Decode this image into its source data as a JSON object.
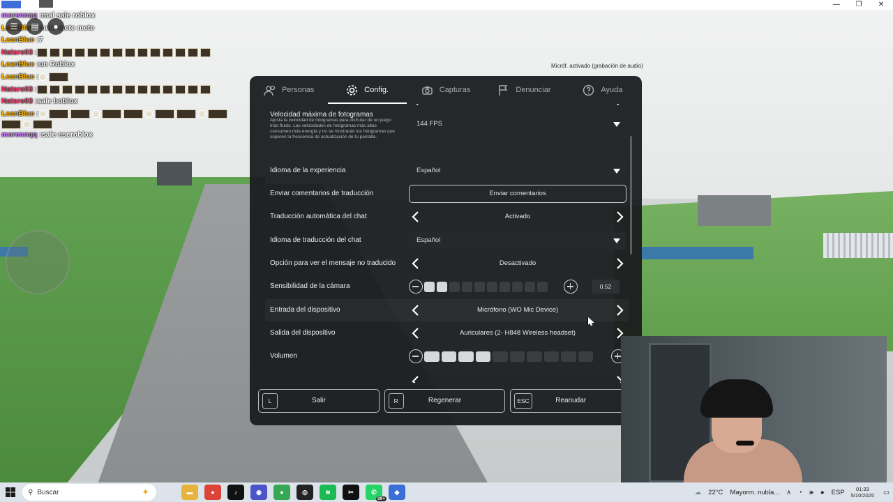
{
  "window": {
    "minimize": "—",
    "restore": "❐",
    "close": "✕"
  },
  "scene": {
    "mic_notice": "Micróf. activado (grabación de audio)"
  },
  "chat": [
    {
      "name": "morennqq",
      "name_color": "#c678f0",
      "sep": " : ",
      "text": "mal sale roblox"
    },
    {
      "name": "LeanBlue",
      "name_color": "#ffb400",
      "sep": " : ",
      "text": "mete mete mete"
    },
    {
      "name": "LeanBlue",
      "name_color": "#ffb400",
      "sep": " : ",
      "text": "7"
    },
    {
      "name": "Natsro03",
      "name_color": "#ff3366",
      "sep": " : ",
      "text": ""
    },
    {
      "name": "LeanBlue",
      "name_color": "#ffb400",
      "sep": " : ",
      "text": "un Roblox"
    },
    {
      "name": "LeanBlue",
      "name_color": "#ffb400",
      "sep": " : ",
      "text": ""
    },
    {
      "name": "Natsro03",
      "name_color": "#ff3366",
      "sep": " : ",
      "text": ""
    },
    {
      "name": "Natsro03",
      "name_color": "#ff3366",
      "sep": " : ",
      "text": "sale boblox"
    },
    {
      "name": "LeanBlue",
      "name_color": "#ffb400",
      "sep": " : ",
      "text": ""
    },
    {
      "name": "morennqq",
      "name_color": "#c678f0",
      "sep": " : ",
      "text": "sale eseroblox"
    }
  ],
  "tabs": [
    {
      "label": "Personas",
      "icon": "people-icon"
    },
    {
      "label": "Config.",
      "icon": "gear-icon",
      "active": true
    },
    {
      "label": "Capturas",
      "icon": "camera-icon"
    },
    {
      "label": "Denunciar",
      "icon": "flag-icon"
    },
    {
      "label": "Ayuda",
      "icon": "help-icon"
    }
  ],
  "settings": {
    "fps": {
      "label": "Velocidad máxima de fotogramas",
      "description": "Ajusta la velocidad de fotogramas para disfrutar de un juego más fluido. Las velocidades de fotogramas más altas consumen más energía y no se mostrarán los fotogramas que superen la frecuencia de actualización de tu pantalla.",
      "value": "144 FPS"
    },
    "experience_language": {
      "label": "Idioma de la experiencia",
      "value": "Español"
    },
    "translation_feedback": {
      "label": "Enviar comentarios de traducción",
      "button": "Enviar comentarios"
    },
    "chat_autotranslate": {
      "label": "Traducción automática del chat",
      "value": "Activado"
    },
    "chat_translation_language": {
      "label": "Idioma de traducción del chat",
      "value": "Español"
    },
    "untranslated_option": {
      "label": "Opción para ver el mensaje no traducido",
      "value": "Desactivado"
    },
    "camera_sensitivity": {
      "label": "Sensibilidad de la cámara",
      "value": "0.52",
      "level": 0.2,
      "segments": 10
    },
    "input_device": {
      "label": "Entrada del dispositivo",
      "value": "Micrófono (WO Mic Device)"
    },
    "output_device": {
      "label": "Salida del dispositivo",
      "value": "Auriculares (2- H848 Wireless headset)"
    },
    "volume": {
      "label": "Volumen",
      "level": 0.4,
      "segments": 10
    }
  },
  "footer": [
    {
      "key": "L",
      "label": "Salir"
    },
    {
      "key": "R",
      "label": "Regenerar"
    },
    {
      "key": "ESC",
      "label": "Reanudar"
    }
  ],
  "taskbar": {
    "search_placeholder": "Buscar",
    "apps": [
      {
        "name": "file-explorer-icon",
        "color": "#e8b33c",
        "glyph": "▬"
      },
      {
        "name": "chrome-icon",
        "color": "#db4437",
        "glyph": "●"
      },
      {
        "name": "tiktok-icon",
        "color": "#111111",
        "glyph": "♪"
      },
      {
        "name": "browser-icon",
        "color": "#4a56c8",
        "glyph": "◉"
      },
      {
        "name": "chrome-profile-icon",
        "color": "#34a853",
        "glyph": "●"
      },
      {
        "name": "obs-icon",
        "color": "#222222",
        "glyph": "◎"
      },
      {
        "name": "spotify-icon",
        "color": "#1db954",
        "glyph": "≋"
      },
      {
        "name": "capcut-icon",
        "color": "#111111",
        "glyph": "✂"
      },
      {
        "name": "whatsapp-icon",
        "color": "#25d366",
        "glyph": "✆",
        "count": "99+"
      },
      {
        "name": "roblox-icon",
        "color": "#3a6fd8",
        "glyph": "◆"
      }
    ],
    "weather_temp": "22°C",
    "weather_text": "Mayorm. nubla...",
    "lang": "ESP",
    "time": "01:33",
    "date": "5/10/2025"
  }
}
